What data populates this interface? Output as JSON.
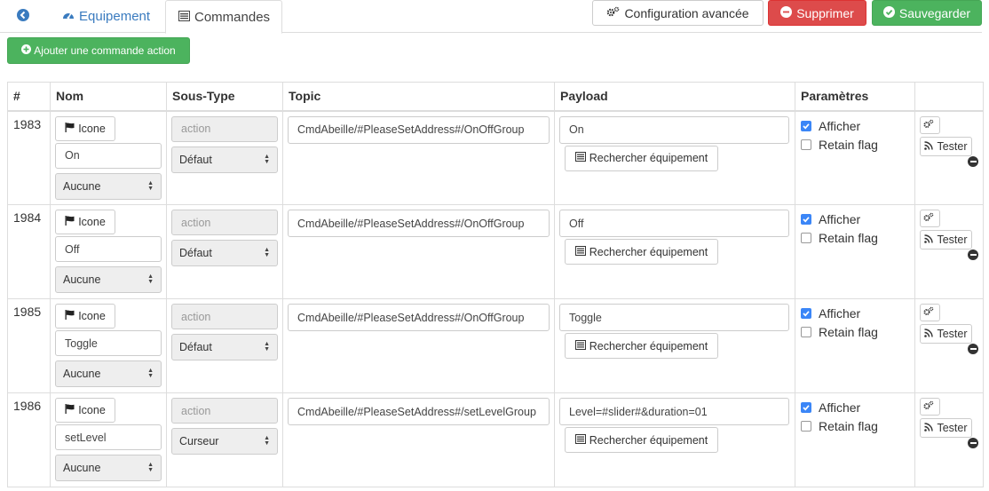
{
  "tabs": {
    "back_icon": "arrow-circle-left-icon",
    "equipement": "Equipement",
    "commandes": "Commandes"
  },
  "toolbar": {
    "config_label": "Configuration avancée",
    "delete_label": "Supprimer",
    "save_label": "Sauvegarder",
    "add_label": "Ajouter une commande action"
  },
  "colors": {
    "accent_blue": "#3a7bbf",
    "delete_red": "#dd4b4b",
    "save_green": "#4cb35e",
    "checkbox_blue": "#3b86f7"
  },
  "table": {
    "headers": [
      "#",
      "Nom",
      "Sous-Type",
      "Topic",
      "Payload",
      "Paramètres",
      ""
    ],
    "rows": [
      {
        "id": "1983",
        "icon_label": "Icone",
        "name": "On",
        "unit_select": "Aucune",
        "subtype": "action",
        "subtype_select": "Défaut",
        "topic": "CmdAbeille/#PleaseSetAddress#/OnOffGroup",
        "payload": "On",
        "search_label": "Rechercher équipement",
        "afficher": "Afficher",
        "afficher_checked": true,
        "retain": "Retain flag",
        "retain_checked": false,
        "tester": "Tester"
      },
      {
        "id": "1984",
        "icon_label": "Icone",
        "name": "Off",
        "unit_select": "Aucune",
        "subtype": "action",
        "subtype_select": "Défaut",
        "topic": "CmdAbeille/#PleaseSetAddress#/OnOffGroup",
        "payload": "Off",
        "search_label": "Rechercher équipement",
        "afficher": "Afficher",
        "afficher_checked": true,
        "retain": "Retain flag",
        "retain_checked": false,
        "tester": "Tester"
      },
      {
        "id": "1985",
        "icon_label": "Icone",
        "name": "Toggle",
        "unit_select": "Aucune",
        "subtype": "action",
        "subtype_select": "Défaut",
        "topic": "CmdAbeille/#PleaseSetAddress#/OnOffGroup",
        "payload": "Toggle",
        "search_label": "Rechercher équipement",
        "afficher": "Afficher",
        "afficher_checked": true,
        "retain": "Retain flag",
        "retain_checked": false,
        "tester": "Tester"
      },
      {
        "id": "1986",
        "icon_label": "Icone",
        "name": "setLevel",
        "unit_select": "Aucune",
        "subtype": "action",
        "subtype_select": "Curseur",
        "topic": "CmdAbeille/#PleaseSetAddress#/setLevelGroup",
        "payload": "Level=#slider#&duration=01",
        "search_label": "Rechercher équipement",
        "afficher": "Afficher",
        "afficher_checked": true,
        "retain": "Retain flag",
        "retain_checked": false,
        "tester": "Tester"
      }
    ]
  }
}
